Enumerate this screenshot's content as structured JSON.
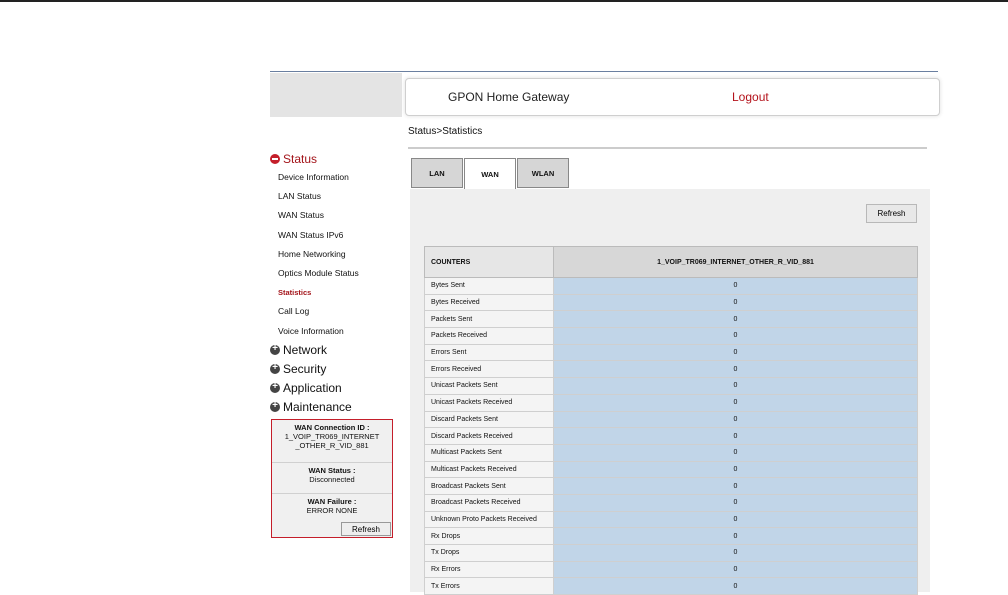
{
  "header": {
    "title": "GPON Home Gateway",
    "logout": "Logout"
  },
  "breadcrumb": "Status>Statistics",
  "sidebar": {
    "status_label": "Status",
    "status_items": [
      "Device Information",
      "LAN Status",
      "WAN Status",
      "WAN Status IPv6",
      "Home Networking",
      "Optics Module Status",
      "Statistics",
      "Call Log",
      "Voice Information"
    ],
    "active_item": "Statistics",
    "groups": [
      "Network",
      "Security",
      "Application",
      "Maintenance"
    ]
  },
  "info_box": {
    "conn_label": "WAN Connection ID :",
    "conn_value": "1_VOIP_TR069_INTERNET\n_OTHER_R_VID_881",
    "status_label": "WAN Status :",
    "status_value": "Disconnected",
    "failure_label": "WAN Failure :",
    "failure_value": "ERROR NONE",
    "refresh": "Refresh"
  },
  "tabs": [
    "LAN",
    "WAN",
    "WLAN"
  ],
  "active_tab": "WAN",
  "refresh_label": "Refresh",
  "table": {
    "col1": "COUNTERS",
    "col2": "1_VOIP_TR069_INTERNET_OTHER_R_VID_881",
    "rows": [
      {
        "label": "Bytes Sent",
        "value": "0"
      },
      {
        "label": "Bytes Received",
        "value": "0"
      },
      {
        "label": "Packets Sent",
        "value": "0"
      },
      {
        "label": "Packets Received",
        "value": "0"
      },
      {
        "label": "Errors Sent",
        "value": "0"
      },
      {
        "label": "Errors Received",
        "value": "0"
      },
      {
        "label": "Unicast Packets Sent",
        "value": "0"
      },
      {
        "label": "Unicast Packets Received",
        "value": "0"
      },
      {
        "label": "Discard Packets Sent",
        "value": "0"
      },
      {
        "label": "Discard Packets Received",
        "value": "0"
      },
      {
        "label": "Multicast Packets Sent",
        "value": "0"
      },
      {
        "label": "Multicast Packets Received",
        "value": "0"
      },
      {
        "label": "Broadcast Packets Sent",
        "value": "0"
      },
      {
        "label": "Broadcast Packets Received",
        "value": "0"
      },
      {
        "label": "Unknown Proto Packets Received",
        "value": "0"
      },
      {
        "label": "Rx Drops",
        "value": "0"
      },
      {
        "label": "Tx Drops",
        "value": "0"
      },
      {
        "label": "Rx Errors",
        "value": "0"
      },
      {
        "label": "Tx Errors",
        "value": "0"
      }
    ]
  }
}
